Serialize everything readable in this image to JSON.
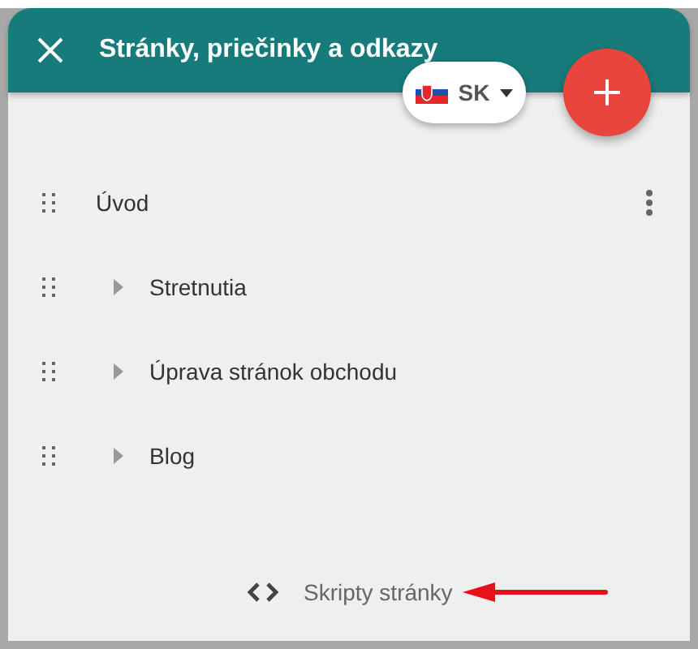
{
  "header": {
    "title": "Stránky, priečinky a odkazy"
  },
  "language": {
    "code": "SK"
  },
  "pages": [
    {
      "title": "Úvod",
      "kind": "page",
      "menu_shown": true
    },
    {
      "title": "Stretnutia",
      "kind": "folder",
      "expanded": false,
      "menu_shown": false
    },
    {
      "title": "Úprava stránok obchodu",
      "kind": "folder",
      "expanded": false,
      "menu_shown": false
    },
    {
      "title": "Blog",
      "kind": "folder",
      "expanded": false,
      "menu_shown": false
    }
  ],
  "footer": {
    "link": "Skripty stránky"
  }
}
